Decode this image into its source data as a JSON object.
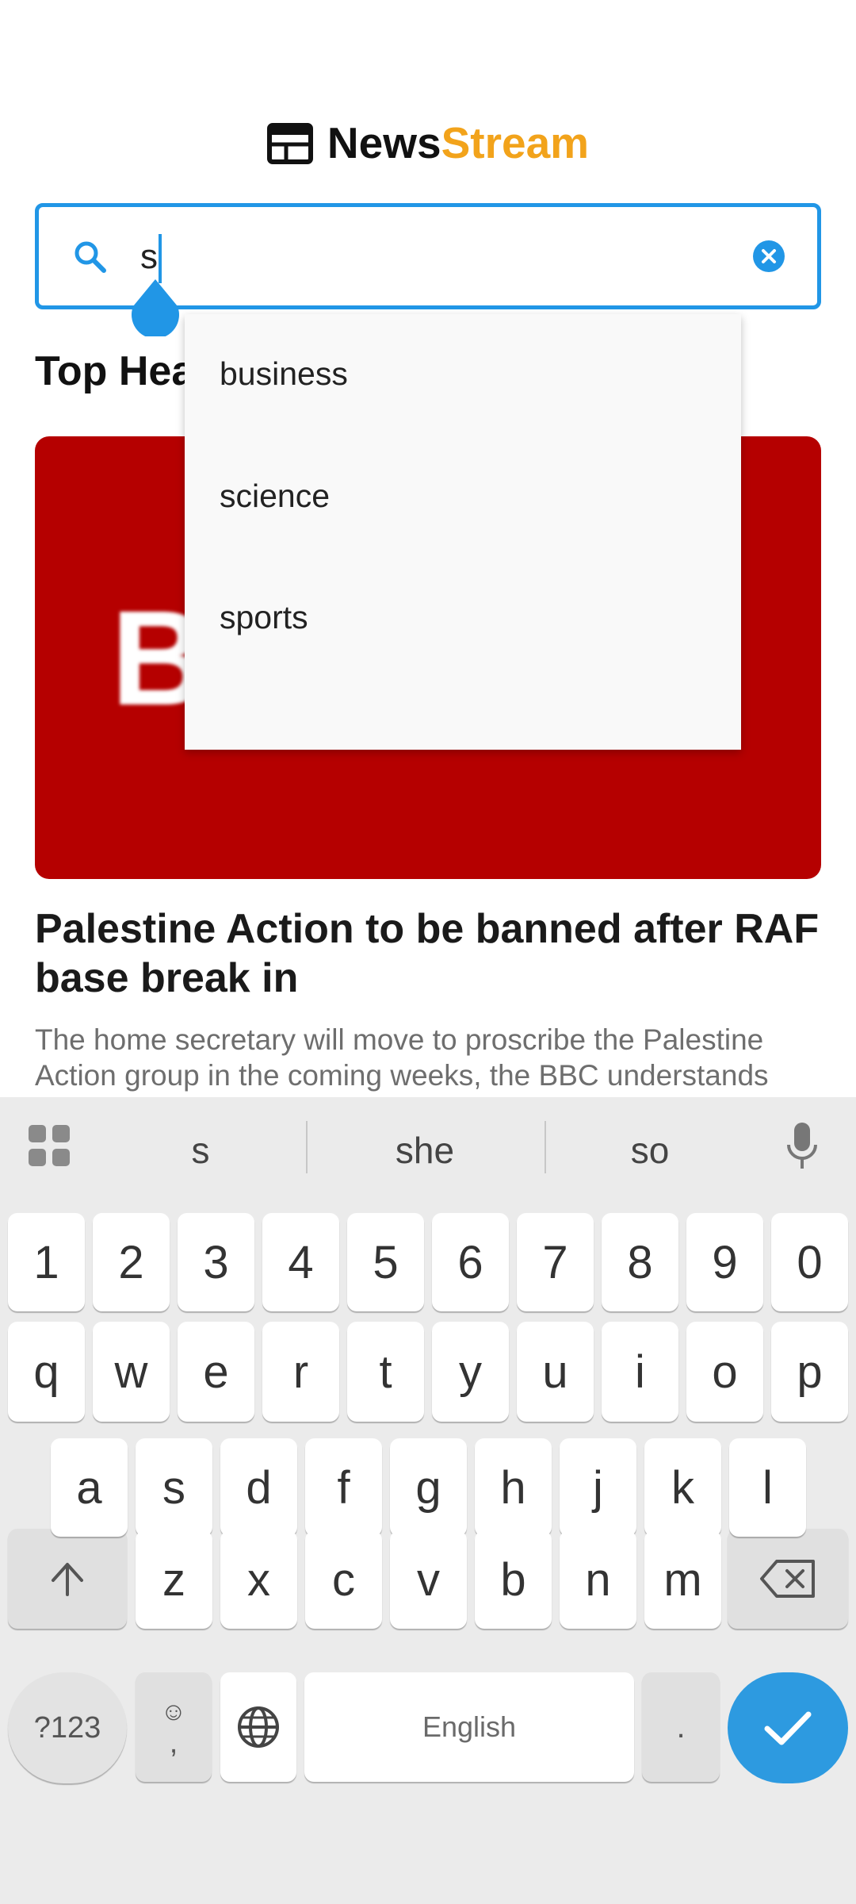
{
  "header": {
    "brand_part1": "News",
    "brand_part2": "Stream",
    "logo_icon": "newspaper-icon",
    "brand_accent_color": "#f2a31b"
  },
  "search": {
    "value": "s",
    "search_icon": "search-icon",
    "clear_icon": "clear-icon",
    "accent_color": "#2196e6"
  },
  "section": {
    "title": "Top Headlines"
  },
  "article": {
    "image_letter": "B",
    "headline": "Palestine Action to be banned after RAF base break in",
    "summary": "The home secretary will move to proscribe the Palestine Action group in the coming weeks, the BBC understands",
    "image_color": "#b50000"
  },
  "dropdown": {
    "items": [
      "business",
      "science",
      "sports"
    ]
  },
  "keyboard": {
    "suggestions": [
      "s",
      "she",
      "so"
    ],
    "row_numbers": [
      "1",
      "2",
      "3",
      "4",
      "5",
      "6",
      "7",
      "8",
      "9",
      "0"
    ],
    "row1": [
      "q",
      "w",
      "e",
      "r",
      "t",
      "y",
      "u",
      "i",
      "o",
      "p"
    ],
    "row2": [
      "a",
      "s",
      "d",
      "f",
      "g",
      "h",
      "j",
      "k",
      "l"
    ],
    "row3": [
      "z",
      "x",
      "c",
      "v",
      "b",
      "n",
      "m"
    ],
    "symbols_label": "?123",
    "comma_label": ",",
    "space_label": "English",
    "period_label": ".",
    "emoji_label": "☺"
  }
}
